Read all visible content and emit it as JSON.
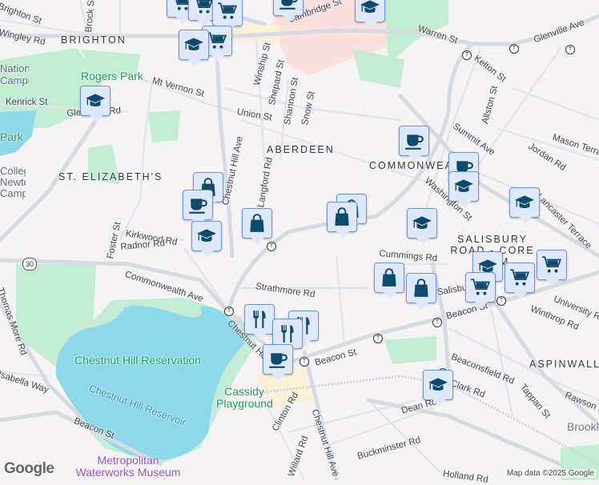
{
  "map": {
    "neighborhoods": [
      "BRIGHTON",
      "ABERDEEN",
      "ST. ELIZABETH'S",
      "COMMONWEALTH",
      "SALISBURY ROAD - CORE FARM",
      "ASPINWALL"
    ],
    "parks": [
      "Rogers Park",
      "Chestnut Hill Reservation",
      "Cassidy Playground",
      "Park"
    ],
    "water": [
      "Chestnut Hill Reservoir"
    ],
    "museum": "Metropolitan Waterworks Museum",
    "pois": [
      "National Campus...",
      "College Newton Campus"
    ],
    "towns": [
      "Brookline"
    ],
    "route_shield": "30",
    "streets": [
      "Cambridge St",
      "Warren St",
      "Glenville Ave",
      "Kelton St",
      "Allston St",
      "Summit Ave",
      "Mason Terrace",
      "Jordan Rd",
      "Washington St",
      "Lancaster Terrace",
      "Winship St",
      "Shepard St",
      "Shannon St",
      "Snow St",
      "Union St",
      "Mt Vernon St",
      "Kenrick St",
      "Glenmont Rd",
      "Chestnut Hill Ave",
      "Langford Rd",
      "Kirkwood Rd",
      "Radnor Rd",
      "Foster St",
      "Commonwealth Ave",
      "Strathmore Rd",
      "Cummings Rd",
      "Salisbury Rd",
      "Beacon St",
      "Beaconsfield Rd",
      "Winthrop Rd",
      "University Rd",
      "Tappan St",
      "Rawson Rd",
      "Dean Rd",
      "Clark Rd",
      "Buckminster Rd",
      "Clinton Rd",
      "Willard Rd",
      "Holland Rd",
      "Thomas More Rd",
      "Isabella Way",
      "Brock St",
      "Wingley Rd",
      "Brighton St"
    ]
  },
  "markers": {
    "icons": {
      "grocery": "cart-icon",
      "school": "graduation-cap-icon",
      "cafe": "coffee-cup-icon",
      "shop": "shopping-bag-icon",
      "restaurant": "fork-knife-icon"
    },
    "color": "#0d4a6e",
    "fill": "#dfe9fc",
    "border": "#6e93d6"
  },
  "branding": {
    "logo": "Google",
    "attribution": "Map data ©2025 Google"
  },
  "colors": {
    "land": "#f5f3f3",
    "park": "#c3edd3",
    "water": "#8ed8ec",
    "road": "#dde2ea",
    "hospital": "#fbe0de",
    "commercial": "#fbf0d6"
  }
}
